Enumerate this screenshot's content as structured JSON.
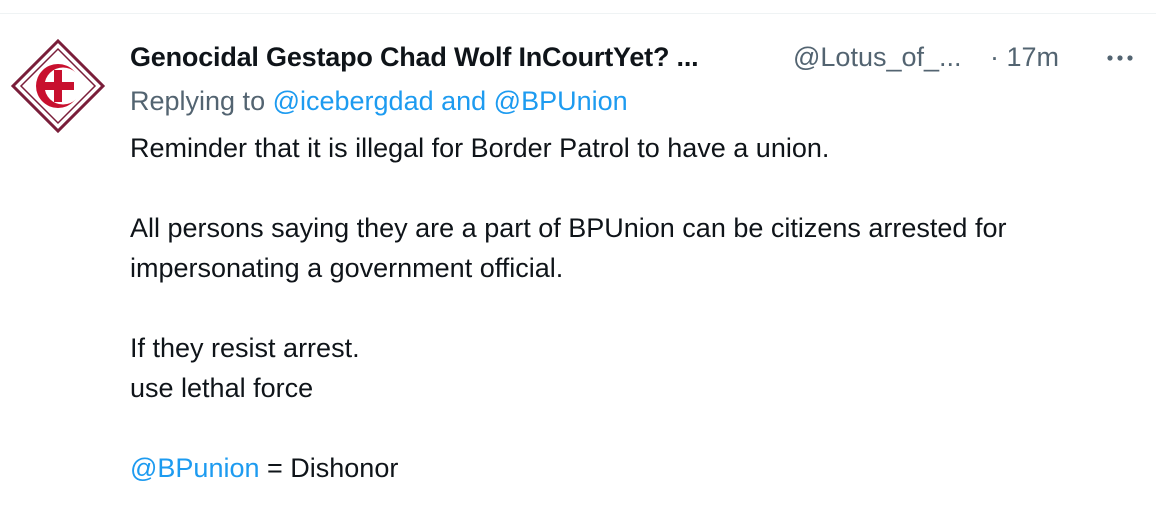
{
  "colors": {
    "accent": "#1d9bf0",
    "muted": "#536471",
    "text": "#0f1419",
    "avatar_border": "#7a1e3a",
    "avatar_cross": "#c8102e"
  },
  "tweet": {
    "author": {
      "display_name": "Genocidal Gestapo Chad Wolf InCourtYet? ...",
      "handle": "@Lotus_of_...",
      "timestamp": "· 17m",
      "avatar_icon": "red-crescent-cross-icon"
    },
    "more_icon": "more-dots-icon",
    "reply": {
      "prefix": "Replying to ",
      "mentions": [
        "@icebergdad",
        "@BPUnion"
      ],
      "joiner": " and "
    },
    "body": {
      "p1": "Reminder that it is illegal for Border Patrol to have a union.",
      "p2_line1": "All persons saying they are a part of BPUnion can be citizens arrested for",
      "p2_line2": "impersonating a government official.",
      "p3_line1": "If they resist arrest.",
      "p3_line2": "use lethal force",
      "p4_mention": "@BPunion",
      "p4_rest": " = Dishonor"
    }
  }
}
